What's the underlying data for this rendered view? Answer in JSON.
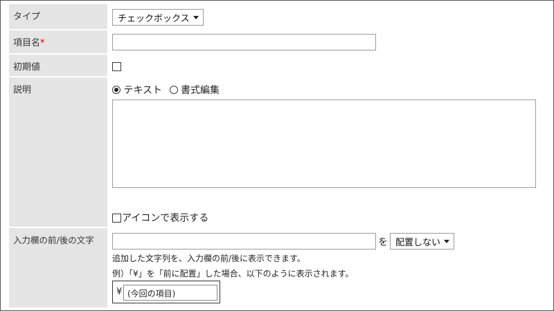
{
  "form": {
    "type": {
      "label": "タイプ",
      "value": "チェックボックス"
    },
    "item_name": {
      "label": "項目名",
      "required_mark": "*",
      "value": ""
    },
    "initial_value": {
      "label": "初期値",
      "checked": false
    },
    "description": {
      "label": "説明",
      "mode_text": "テキスト",
      "mode_rich": "書式編集",
      "selected_mode": "テキスト",
      "body": "",
      "show_icon_label": "アイコンで表示する"
    },
    "affix": {
      "label": "入力欄の前/後の文字",
      "value": "",
      "connector": "を",
      "position_value": "配置しない",
      "help": "追加した文字列を、入力欄の前/後に表示できます。",
      "example": "例）「¥」を「前に配置」した場合、以下のように表示されます。",
      "example_prefix": "¥",
      "example_placeholder": "(今回の項目)"
    }
  }
}
